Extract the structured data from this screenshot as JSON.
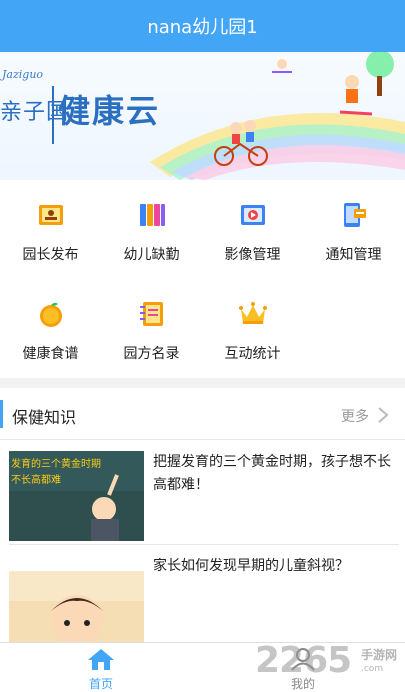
{
  "header": {
    "title": "nana幼儿园1"
  },
  "banner": {
    "subtitle": "Jaziguo",
    "brand_left": "亲子国",
    "brand_main": "健康云"
  },
  "grid": {
    "items": [
      {
        "label": "园长发布",
        "icon": "id-card-icon"
      },
      {
        "label": "幼儿缺勤",
        "icon": "binders-icon"
      },
      {
        "label": "影像管理",
        "icon": "video-book-icon"
      },
      {
        "label": "通知管理",
        "icon": "notice-phone-icon"
      },
      {
        "label": "健康食谱",
        "icon": "orange-icon"
      },
      {
        "label": "园方名录",
        "icon": "notebook-icon"
      },
      {
        "label": "互动统计",
        "icon": "crown-icon"
      }
    ]
  },
  "section": {
    "title": "保健知识",
    "more": "更多"
  },
  "articles": [
    {
      "title": "把握发育的三个黄金时期，孩子想不长高都难！",
      "thumb_caption_1": "发育的三个黄金时期",
      "thumb_caption_2": "不长高都难"
    },
    {
      "title": "家长如何发现早期的儿童斜视？"
    }
  ],
  "tabs": [
    {
      "label": "首页",
      "active": true,
      "color": "#42a5f5"
    },
    {
      "label": "我的",
      "active": false,
      "color": "#888888"
    }
  ],
  "watermark": {
    "number": "2265",
    "cn": "手游网",
    "url": ".com"
  },
  "colors": {
    "accent": "#42a5f5",
    "text": "#222222",
    "muted": "#999999"
  }
}
